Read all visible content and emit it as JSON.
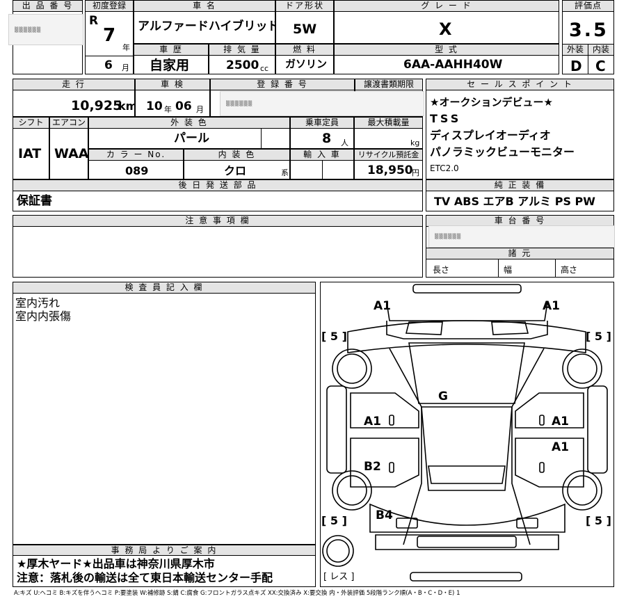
{
  "header_labels": {
    "lot_no": "出 品 番 号",
    "first_reg": "初度登録",
    "car_name": "車 名",
    "door": "ドア形状",
    "grade": "グ レ ー ド",
    "score": "評価点",
    "history": "車 歴",
    "displacement": "排 気 量",
    "fuel": "燃 料",
    "model": "型 式",
    "exterior": "外装",
    "interior": "内装",
    "mileage": "走 行",
    "inspection": "車 検",
    "reg_no": "登 録 番 号",
    "transfer": "譲渡書類期限",
    "sales_point": "セ ー ル ス ポ イ ン ト",
    "shift": "シフト",
    "aircon": "エアコン",
    "ext_color": "外 装 色",
    "capacity": "乗車定員",
    "max_load": "最大積載量",
    "color_no": "カ ラ ー No.",
    "int_color": "内 装 色",
    "import": "輸 入 車",
    "recycle": "リサイクル預託金",
    "later_parts": "後 日 発 送 部 品",
    "genuine": "純 正 装 備",
    "notes": "注 意 事 項 欄",
    "chassis": "車 台 番 号",
    "specs": "諸 元",
    "inspector": "検 査 員 記 入 欄",
    "office": "事 務 局 よ り ご 案 内"
  },
  "values": {
    "era": "R",
    "year": "7",
    "year_unit": "年",
    "month": "6",
    "month_unit": "月",
    "car_name": "アルファードハイブリッド",
    "door": "5W",
    "grade": "X",
    "score": "3.5",
    "history": "自家用",
    "displacement": "2500",
    "displacement_unit": "cc",
    "fuel": "ガソリン",
    "model": "6AA-AAHH40W",
    "exterior": "D",
    "interior": "C",
    "mileage": "10,925",
    "mileage_unit": "km",
    "inspection_year": "10",
    "inspection_year_unit": "年",
    "inspection_month": "06",
    "inspection_month_unit": "月",
    "shift": "IAT",
    "aircon": "WAA",
    "ext_color": "パール",
    "capacity": "8",
    "capacity_unit": "人",
    "load_unit": "kg",
    "color_no": "089",
    "int_color": "クロ",
    "int_color_unit": "系",
    "recycle": "18,950",
    "recycle_unit": "円",
    "later_parts": "保証書",
    "genuine": "TV ABS エアB アルミ PS PW",
    "spec_length": "長さ",
    "spec_width": "幅",
    "spec_height": "高さ",
    "redacted": "▒▒▒▒▒▒"
  },
  "sales_points": [
    "★オークションデビュー★",
    "TSS",
    "ディスプレイオーディオ",
    "パノラミックビューモニター",
    "ETC2.0"
  ],
  "inspector_notes": [
    "室内汚れ",
    "室内内張傷"
  ],
  "office_notes": [
    "★厚木ヤード★出品車は神奈川県厚木市",
    "注意：落札後の輸送は全て東日本輸送センター手配"
  ],
  "diagram_marks": {
    "front_left": "A1",
    "front_right": "A1",
    "left_front_tire": "[ 5 ]",
    "right_front_tire": "[ 5 ]",
    "windshield": "G",
    "front_door_left": "A1",
    "front_door_right": "A1",
    "rear_door_right": "A1",
    "rear_door_left": "B2",
    "rear_left": "B4",
    "left_rear_tire": "[ 5 ]",
    "right_rear_tire": "[ 5 ]",
    "spare": "[ レス ]"
  },
  "legend": "A:キズ U:ヘコミ B:キズを伴うヘコミ P:要塗装 W:補修跡 S:錆 C:腐食 G:フロントガラス点キズ XX:交換済み X:要交換 内・外装評価 5段階ランク順(A・B・C・D・E) 1"
}
